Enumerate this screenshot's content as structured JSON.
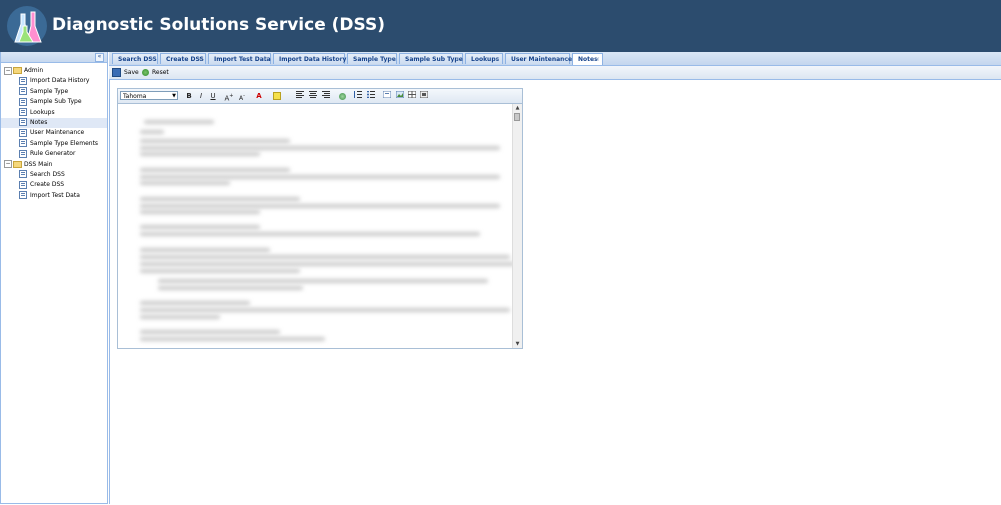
{
  "app": {
    "title": "Diagnostic Solutions Service (DSS)"
  },
  "sidebar": {
    "collapse_label": "«",
    "folders": [
      {
        "label": "Admin",
        "items": [
          "Import Data History",
          "Sample Type",
          "Sample Sub Type",
          "Lookups",
          "Notes",
          "User Maintenance",
          "Sample Type Elements",
          "Rule Generator"
        ]
      },
      {
        "label": "DSS Main",
        "items": [
          "Search DSS",
          "Create DSS",
          "Import Test Data"
        ]
      }
    ],
    "selected": "Notes"
  },
  "tabs": [
    "Search DSS",
    "Create DSS",
    "Import Test Data",
    "Import Data History",
    "Sample Type",
    "Sample Sub Type",
    "Lookups",
    "User Maintenance",
    "Notes"
  ],
  "tab_close": "×",
  "active_tab": "Notes",
  "toolbar": {
    "save_label": "Save",
    "reset_label": "Reset"
  },
  "editor": {
    "font": "Tahoma",
    "buttons": {
      "bold": "B",
      "italic": "I",
      "underline": "U",
      "grow": "A",
      "shrink": "A",
      "forecolor": "A"
    }
  }
}
